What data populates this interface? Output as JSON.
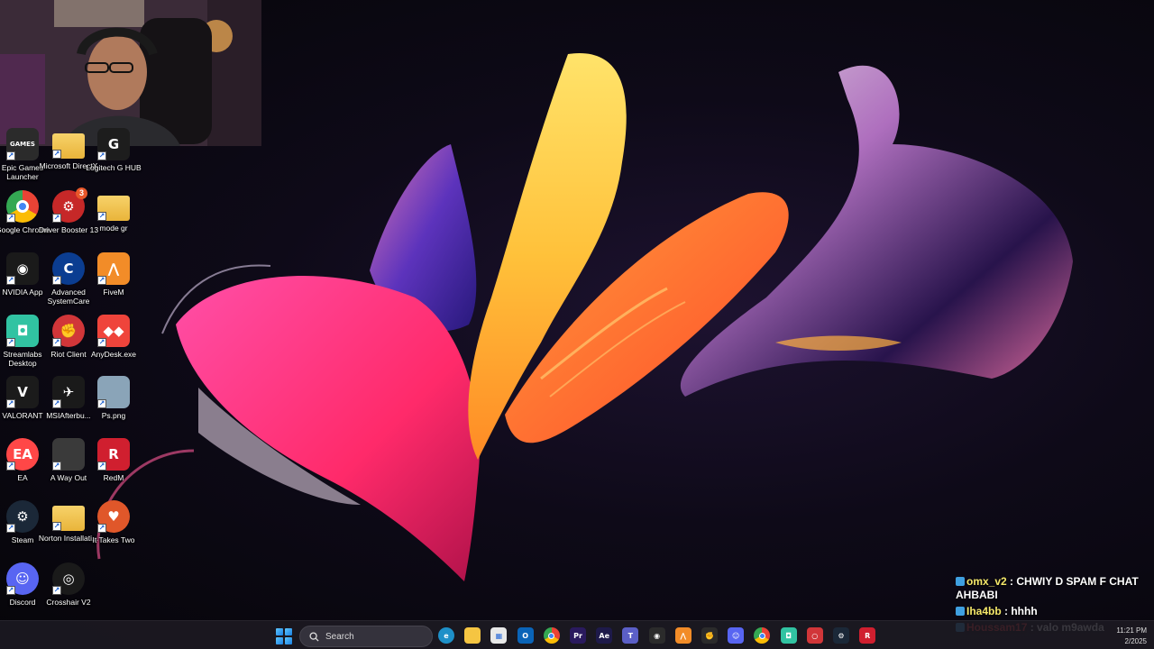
{
  "desktop_icons": [
    {
      "label": "Epic Games Launcher",
      "icon": "epic-games-icon",
      "color": "#2b2b2b"
    },
    {
      "label": "Microsoft DirectX",
      "icon": "folder-icon",
      "color": "#f5c542"
    },
    {
      "label": "Logitech G HUB",
      "icon": "logitech-icon",
      "color": "#1d1d1d"
    },
    {
      "label": "Google Chrome",
      "icon": "chrome-icon",
      "color": "#ffffff"
    },
    {
      "label": "Driver Booster 13",
      "icon": "driver-booster-icon",
      "color": "#c62828",
      "badge": "3"
    },
    {
      "label": "mode gr",
      "icon": "folder-icon",
      "color": "#f5c542"
    },
    {
      "label": "NVIDIA App",
      "icon": "nvidia-icon",
      "color": "#1a1a1a"
    },
    {
      "label": "Advanced SystemCare",
      "icon": "advanced-systemcare-icon",
      "color": "#0b3d91"
    },
    {
      "label": "FiveM",
      "icon": "fivem-icon",
      "color": "#f28c28"
    },
    {
      "label": "Streamlabs Desktop",
      "icon": "streamlabs-icon",
      "color": "#31c3a2"
    },
    {
      "label": "Riot Client",
      "icon": "riot-icon",
      "color": "#d13639"
    },
    {
      "label": "AnyDesk.exe",
      "icon": "anydesk-icon",
      "color": "#ef443b"
    },
    {
      "label": "VALORANT",
      "icon": "valorant-icon",
      "color": "#1b1b1b"
    },
    {
      "label": "MSIAfterbu...",
      "icon": "msi-afterburner-icon",
      "color": "#1a1a1a"
    },
    {
      "label": "Ps.png",
      "icon": "image-file-icon",
      "color": "#8aa4b8"
    },
    {
      "label": "EA",
      "icon": "ea-icon",
      "color": "#ff4747"
    },
    {
      "label": "A Way Out",
      "icon": "a-way-out-icon",
      "color": "#3a3a3a"
    },
    {
      "label": "RedM",
      "icon": "redm-icon",
      "color": "#d01f2f"
    },
    {
      "label": "Steam",
      "icon": "steam-icon",
      "color": "#1b2838"
    },
    {
      "label": "Norton Installati...",
      "icon": "folder-icon",
      "color": "#f5c542"
    },
    {
      "label": "It Takes Two",
      "icon": "it-takes-two-icon",
      "color": "#e0572a"
    },
    {
      "label": "Discord",
      "icon": "discord-icon",
      "color": "#5865f2"
    },
    {
      "label": "Crosshair V2",
      "icon": "crosshair-icon",
      "color": "#1a1a1a"
    }
  ],
  "icon_glyphs": {
    "Epic Games Launcher": "GAMES",
    "Microsoft DirectX": "",
    "Logitech G HUB": "G",
    "Google Chrome": "",
    "Driver Booster 13": "⚙",
    "mode gr": "",
    "NVIDIA App": "◉",
    "Advanced SystemCare": "C",
    "FiveM": "⋀",
    "Streamlabs Desktop": "◘",
    "Riot Client": "✊",
    "AnyDesk.exe": "◆◆",
    "VALORANT": "V",
    "MSIAfterbu...": "✈",
    "Ps.png": "",
    "EA": "EA",
    "A Way Out": "",
    "RedM": "R",
    "Steam": "⚙",
    "Norton Installati...": "",
    "It Takes Two": "♥",
    "Discord": "☺",
    "Crosshair V2": "◎"
  },
  "chat": [
    {
      "user": "omx_v2",
      "user_color": "#f5e86a",
      "message": "CHWIY D SPAM F CHAT AHBABI"
    },
    {
      "user": "Iha4bb",
      "user_color": "#f5e86a",
      "message": "hhhh"
    },
    {
      "user": "Houssam17",
      "user_color": "#ff3d3d",
      "message": "valo m9awda"
    }
  ],
  "taskbar": {
    "search_placeholder": "Search",
    "apps": [
      {
        "name": "edge",
        "icon": "edge-icon",
        "color": "#1e90c8",
        "glyph": "e"
      },
      {
        "name": "file-explorer",
        "icon": "folder-icon",
        "color": "#f5c542",
        "glyph": ""
      },
      {
        "name": "microsoft-store",
        "icon": "store-icon",
        "color": "#e8e8e8",
        "glyph": "▦"
      },
      {
        "name": "outlook",
        "icon": "outlook-icon",
        "color": "#0a64b8",
        "glyph": "O"
      },
      {
        "name": "chrome",
        "icon": "chrome-icon",
        "color": "#ffffff",
        "glyph": ""
      },
      {
        "name": "premiere",
        "icon": "premiere-icon",
        "color": "#2a1a5e",
        "glyph": "Pr"
      },
      {
        "name": "after-effects",
        "icon": "after-effects-icon",
        "color": "#1e1a4a",
        "glyph": "Ae"
      },
      {
        "name": "teams",
        "icon": "teams-icon",
        "color": "#5b5fc7",
        "glyph": "T"
      },
      {
        "name": "nvidia",
        "icon": "nvidia-icon",
        "color": "#2b2b2b",
        "glyph": "◉"
      },
      {
        "name": "fivem",
        "icon": "fivem-icon",
        "color": "#f28c28",
        "glyph": "⋀"
      },
      {
        "name": "riot",
        "icon": "riot-icon",
        "color": "#2b2b2b",
        "glyph": "✊"
      },
      {
        "name": "discord",
        "icon": "discord-icon",
        "color": "#5865f2",
        "glyph": "☺"
      },
      {
        "name": "chrome-2",
        "icon": "chrome-icon",
        "color": "#ffffff",
        "glyph": ""
      },
      {
        "name": "streamlabs",
        "icon": "streamlabs-icon",
        "color": "#31c3a2",
        "glyph": "◘"
      },
      {
        "name": "app-red",
        "icon": "app-icon",
        "color": "#d13639",
        "glyph": "○"
      },
      {
        "name": "steam",
        "icon": "steam-icon",
        "color": "#1b2838",
        "glyph": "⚙"
      },
      {
        "name": "redm",
        "icon": "redm-icon",
        "color": "#d01f2f",
        "glyph": "R"
      }
    ],
    "clock_time": "11:21 PM",
    "clock_date": "2/2025"
  }
}
